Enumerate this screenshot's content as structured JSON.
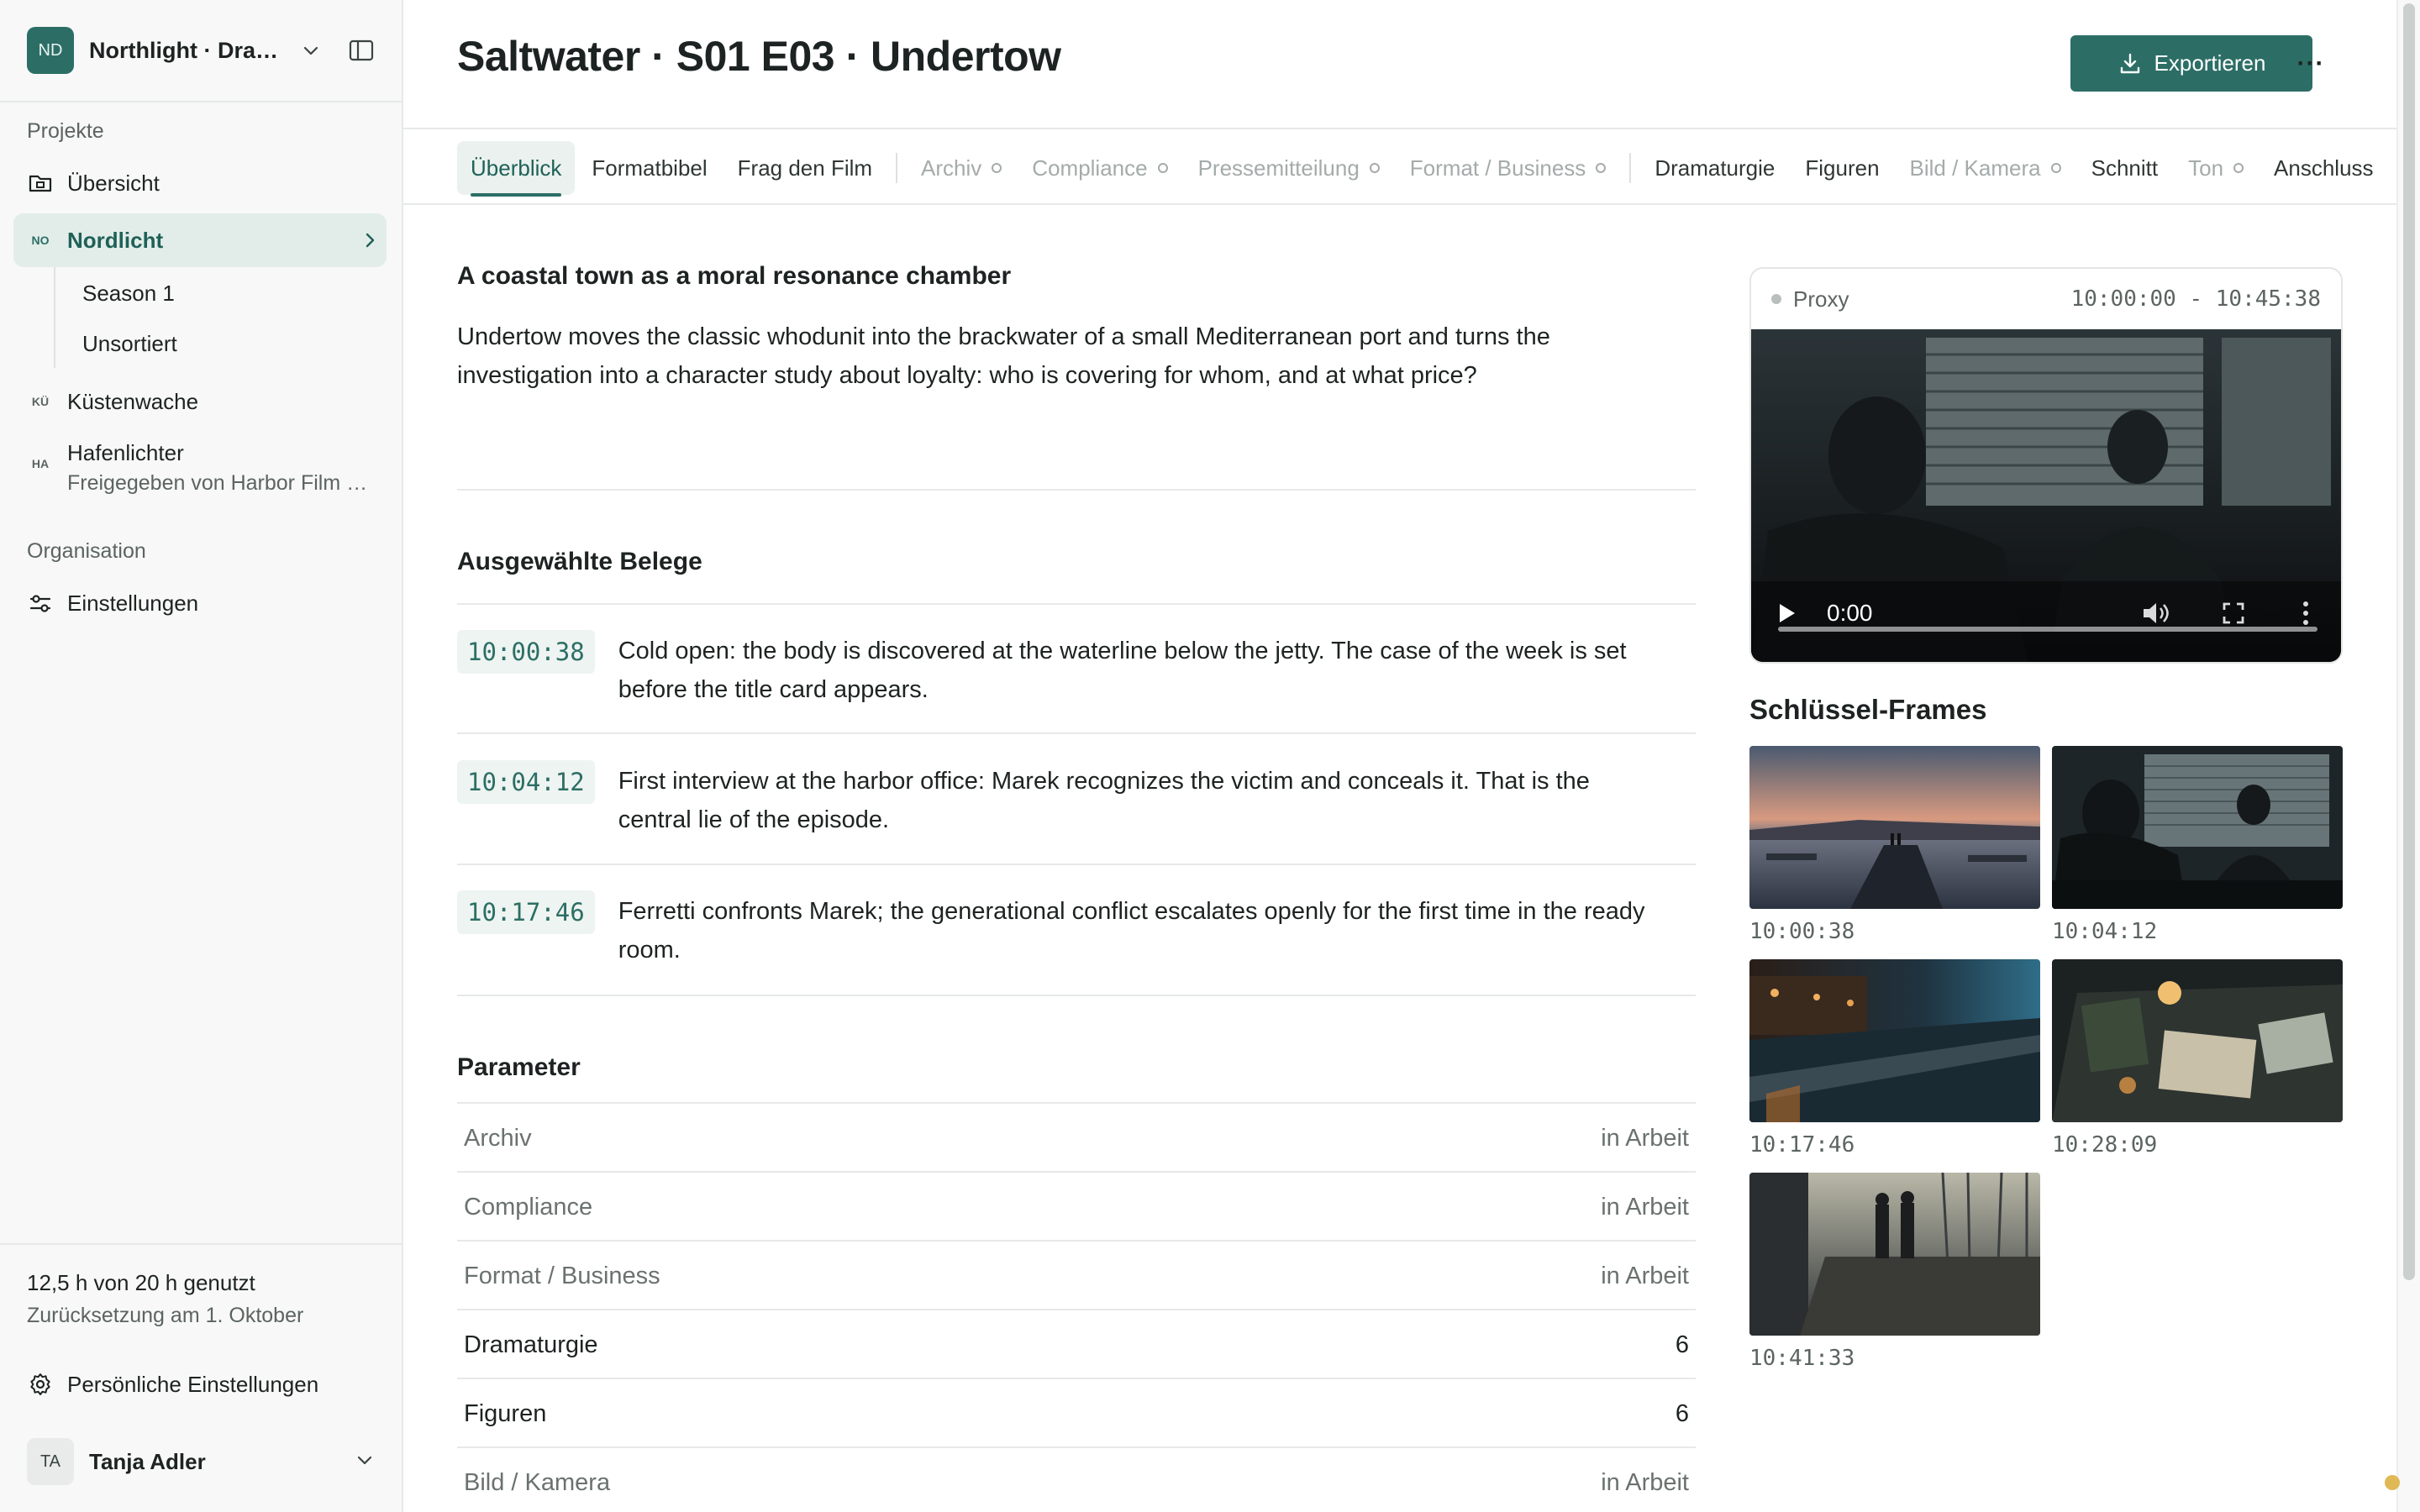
{
  "workspace": {
    "initials": "ND",
    "name": "Northlight · Dram…"
  },
  "sidebar": {
    "projects_label": "Projekte",
    "overview": "Übersicht",
    "projects": [
      {
        "mini": "NO",
        "label": "Nordlicht"
      },
      {
        "mini": "KÜ",
        "label": "Küstenwache"
      },
      {
        "mini": "HA",
        "label": "Hafenlichter",
        "subtitle": "Freigegeben von Harbor Film …"
      }
    ],
    "subitems": [
      "Season 1",
      "Unsortiert"
    ],
    "org_label": "Organisation",
    "settings": "Einstellungen",
    "usage": "12,5 h von 20 h genutzt",
    "reset": "Zurücksetzung am 1. Oktober",
    "personal_settings": "Persönliche Einstellungen",
    "user": {
      "initials": "TA",
      "name": "Tanja Adler"
    }
  },
  "header": {
    "title": "Saltwater · S01 E03 · Undertow",
    "export_label": "Exportieren",
    "more": "···"
  },
  "tabs": [
    {
      "label": "Überblick"
    },
    {
      "label": "Formatbibel"
    },
    {
      "label": "Frag den Film"
    },
    {
      "label": "Archiv"
    },
    {
      "label": "Compliance"
    },
    {
      "label": "Pressemitteilung"
    },
    {
      "label": "Format / Business"
    },
    {
      "label": "Dramaturgie"
    },
    {
      "label": "Figuren"
    },
    {
      "label": "Bild / Kamera"
    },
    {
      "label": "Schnitt"
    },
    {
      "label": "Ton"
    },
    {
      "label": "Anschluss"
    }
  ],
  "overview": {
    "heading": "A coastal town as a moral resonance chamber",
    "lead": "Undertow moves the classic whodunit into the brackwater of a small Mediterranean port and turns the investigation into a character study about loyalty: who is covering for whom, and at what price?",
    "evidence_heading": "Ausgewählte Belege",
    "evidence": [
      {
        "tc": "10:00:38",
        "text": "Cold open: the body is discovered at the waterline below the jetty. The case of the week is set before the title card appears."
      },
      {
        "tc": "10:04:12",
        "text": "First interview at the harbor office: Marek recognizes the victim and conceals it. That is the central lie of the episode."
      },
      {
        "tc": "10:17:46",
        "text": "Ferretti confronts Marek; the generational conflict escalates openly for the first time in the ready room."
      }
    ],
    "params_heading": "Parameter",
    "params": [
      {
        "label": "Archiv",
        "value": "in Arbeit"
      },
      {
        "label": "Compliance",
        "value": "in Arbeit"
      },
      {
        "label": "Format / Business",
        "value": "in Arbeit"
      },
      {
        "label": "Dramaturgie",
        "value": "6"
      },
      {
        "label": "Figuren",
        "value": "6"
      },
      {
        "label": "Bild / Kamera",
        "value": "in Arbeit"
      }
    ]
  },
  "player": {
    "label": "Proxy",
    "range": "10:00:00 - 10:45:38",
    "time": "0:00"
  },
  "keyframes": {
    "heading": "Schlüssel-Frames",
    "items": [
      "10:00:38",
      "10:04:12",
      "10:17:46",
      "10:28:09",
      "10:41:33"
    ]
  },
  "colors": {
    "accent": "#2c6e65",
    "accent_bg": "#e2ede9"
  }
}
